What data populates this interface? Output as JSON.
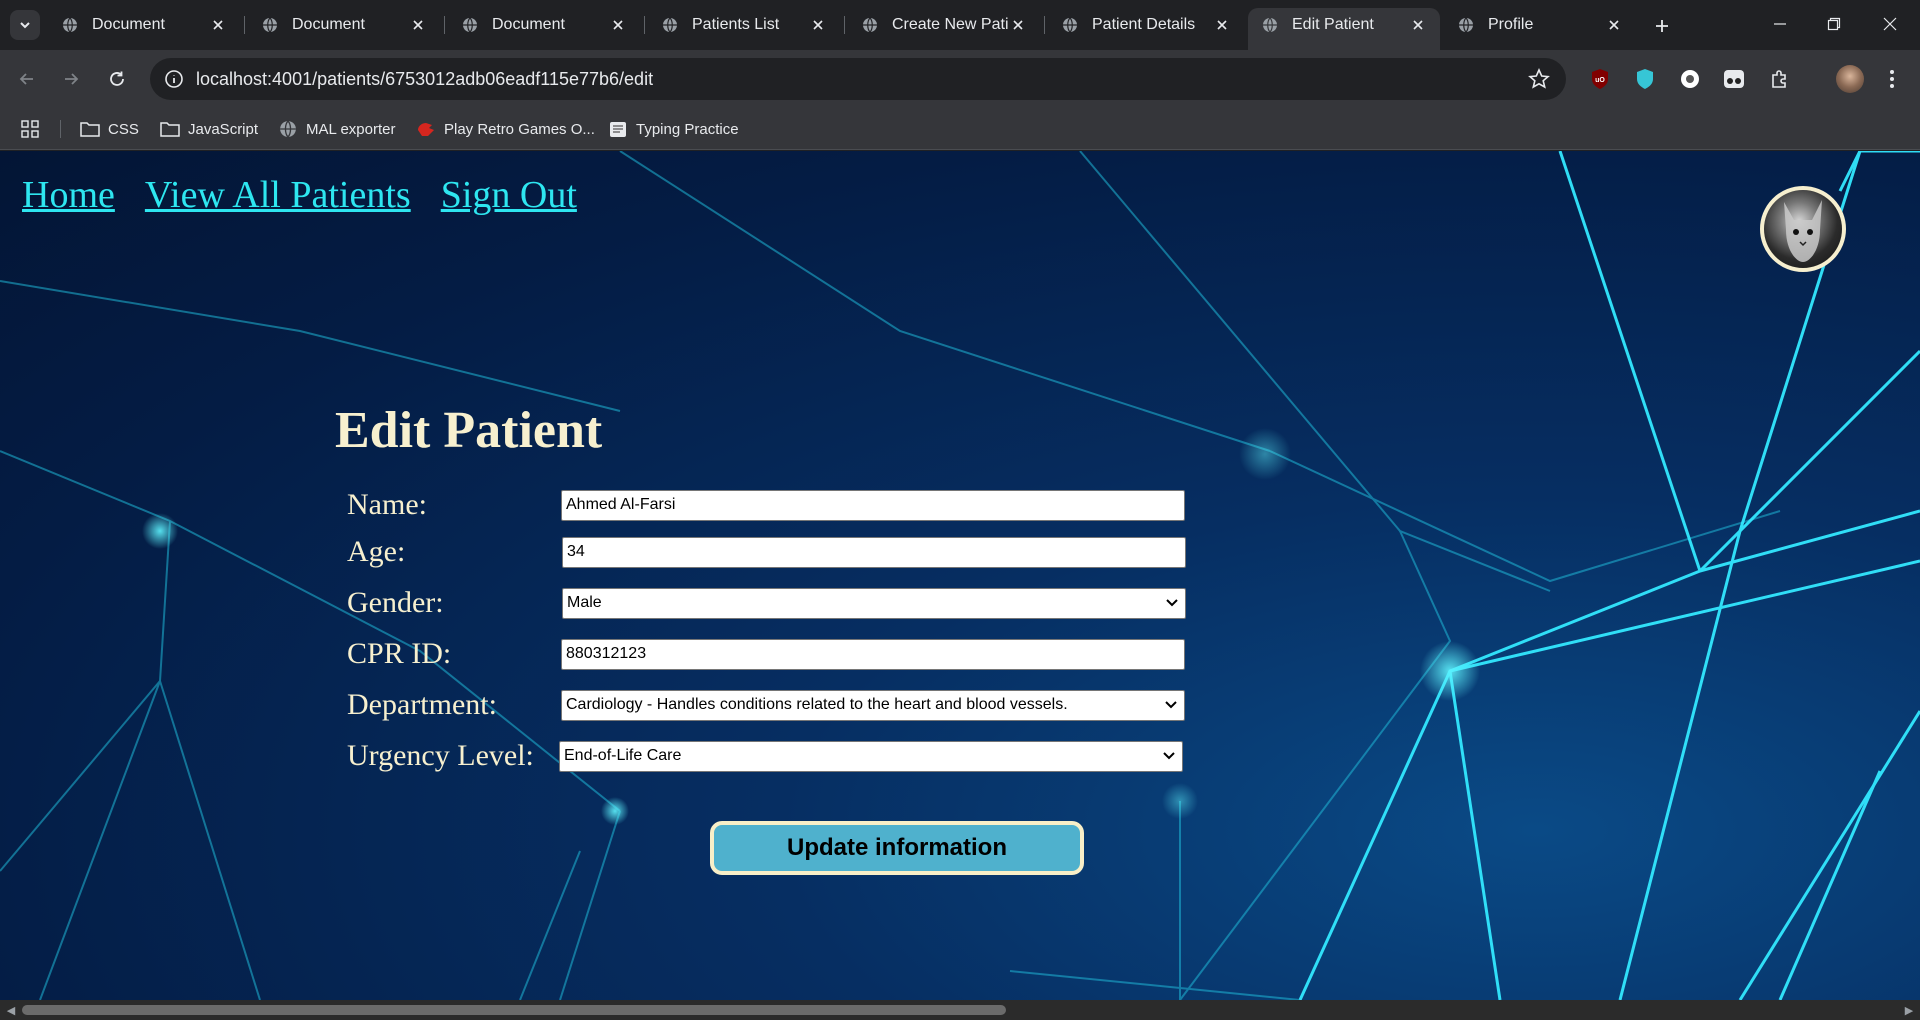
{
  "browser": {
    "tabs": [
      {
        "title": "Document",
        "active": false
      },
      {
        "title": "Document",
        "active": false
      },
      {
        "title": "Document",
        "active": false
      },
      {
        "title": "Patients List",
        "active": false
      },
      {
        "title": "Create New Patient",
        "active": false
      },
      {
        "title": "Patient Details",
        "active": false
      },
      {
        "title": "Edit Patient",
        "active": true
      },
      {
        "title": "Profile",
        "active": false
      }
    ],
    "url": "localhost:4001/patients/6753012adb06eadf115e77b6/edit",
    "bookmarks": [
      {
        "label": "CSS",
        "icon": "folder-icon"
      },
      {
        "label": "JavaScript",
        "icon": "folder-icon"
      },
      {
        "label": "MAL exporter",
        "icon": "globe-icon"
      },
      {
        "label": "Play Retro Games O...",
        "icon": "game-icon"
      },
      {
        "label": "Typing Practice",
        "icon": "keyboard-icon"
      }
    ]
  },
  "nav": {
    "home": "Home",
    "view_all": "View All Patients",
    "sign_out": "Sign Out"
  },
  "form": {
    "title": "Edit Patient",
    "fields": {
      "name": {
        "label": "Name:",
        "value": "Ahmed Al-Farsi"
      },
      "age": {
        "label": "Age:",
        "value": "34"
      },
      "gender": {
        "label": "Gender:",
        "value": "Male"
      },
      "cpr": {
        "label": "CPR ID:",
        "value": "880312123"
      },
      "department": {
        "label": "Department:",
        "value": "Cardiology - Handles conditions related to the heart and blood vessels."
      },
      "urgency": {
        "label": "Urgency Level:",
        "value": "End-of-Life Care"
      }
    },
    "submit_label": "Update information"
  },
  "colors": {
    "link": "#2ee6f0",
    "heading": "#f7f0cf",
    "button": "#4fb1cd"
  }
}
